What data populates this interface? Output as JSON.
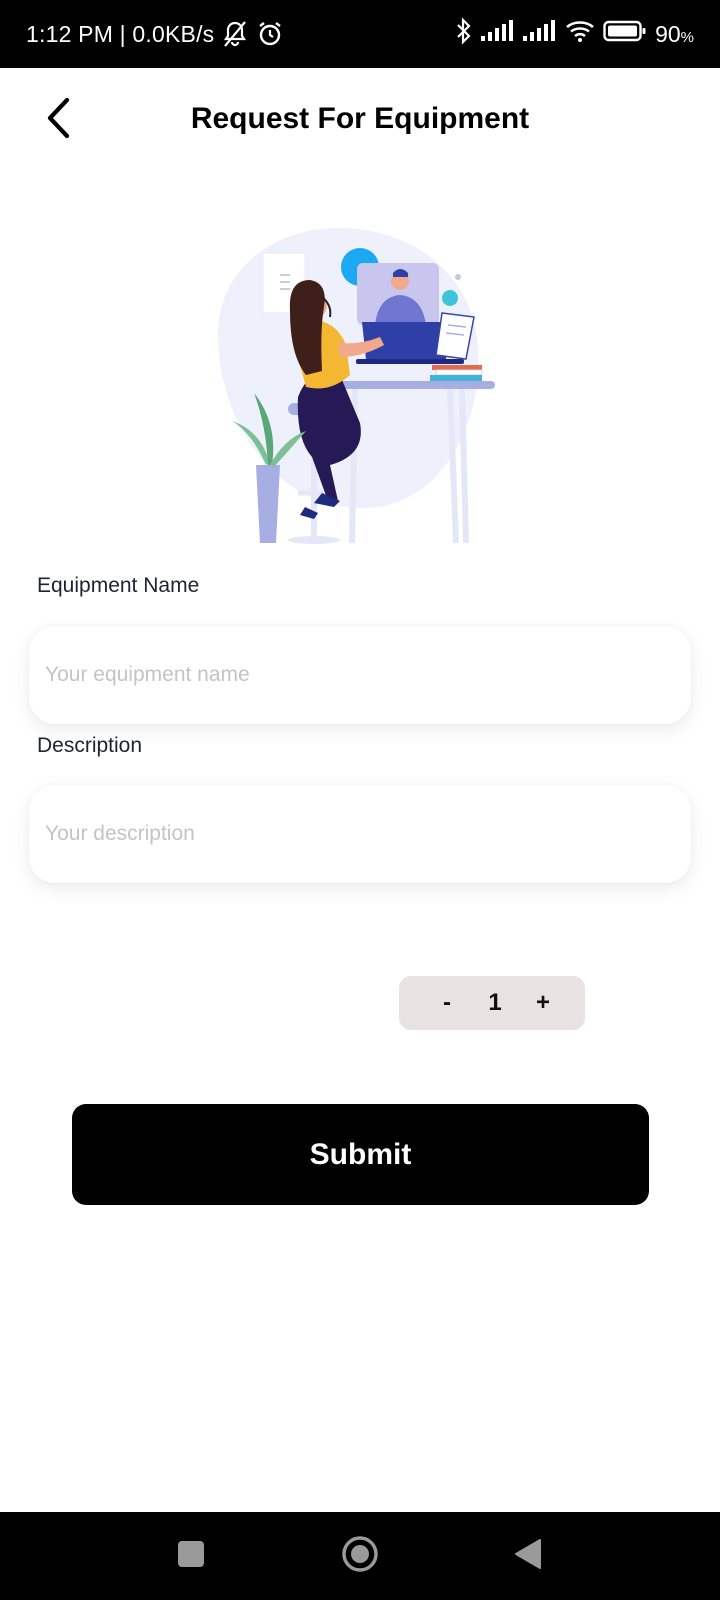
{
  "status_bar": {
    "time_speed": "1:12 PM | 0.0KB/s",
    "battery_value": "90",
    "battery_unit": "%",
    "icons": [
      "bell-off-icon",
      "alarm-icon",
      "bluetooth-icon",
      "signal-icon",
      "signal-icon",
      "wifi-icon",
      "battery-icon"
    ]
  },
  "header": {
    "title": "Request For Equipment",
    "back_icon": "chevron-left-icon"
  },
  "form": {
    "equipment_name": {
      "label": "Equipment Name",
      "placeholder": "Your equipment name",
      "value": ""
    },
    "description": {
      "label": "Description",
      "placeholder": "Your description",
      "value": ""
    },
    "quantity": {
      "decrement_label": "-",
      "value": "1",
      "increment_label": "+"
    },
    "submit_label": "Submit"
  },
  "nav_bar": {
    "icons": [
      "recents-square-icon",
      "home-circle-icon",
      "back-triangle-icon"
    ]
  },
  "colors": {
    "primary": "#000000",
    "stepper_bg": "#e8e2e2",
    "placeholder": "#c4c4c8",
    "illustration_accent": "#2f3fa8"
  }
}
